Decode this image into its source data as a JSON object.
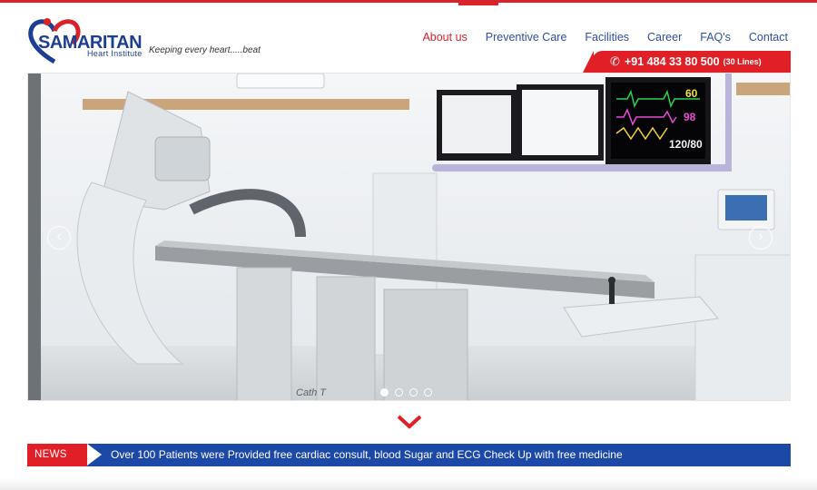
{
  "brand": {
    "name": "SAMARITAN",
    "subtitle": "Heart Institute",
    "tagline": "Keeping every heart.....beat",
    "colors": {
      "red": "#d8232a",
      "blue": "#1c3f95"
    }
  },
  "nav": {
    "items": [
      {
        "label": "About us",
        "active": true
      },
      {
        "label": "Preventive Care",
        "active": false
      },
      {
        "label": "Facilities",
        "active": false
      },
      {
        "label": "Career",
        "active": false
      },
      {
        "label": "FAQ's",
        "active": false
      },
      {
        "label": "Contact",
        "active": false
      }
    ]
  },
  "phone": {
    "icon": "phone-icon",
    "number": "+91 484 33 80 500",
    "lines": "(30 Lines)"
  },
  "slider": {
    "prev_icon": "chevron-left-icon",
    "next_icon": "chevron-right-icon",
    "monitor": {
      "value_1": "60",
      "value_2": "98",
      "value_3": "120/80",
      "label_2": "Cath T"
    },
    "slide_count": 4,
    "active_slide": 1
  },
  "news": {
    "label": "NEWS",
    "text": "Over 100 Patients were Provided free cardiac consult, blood Sugar and ECG Check Up with free medicine"
  }
}
